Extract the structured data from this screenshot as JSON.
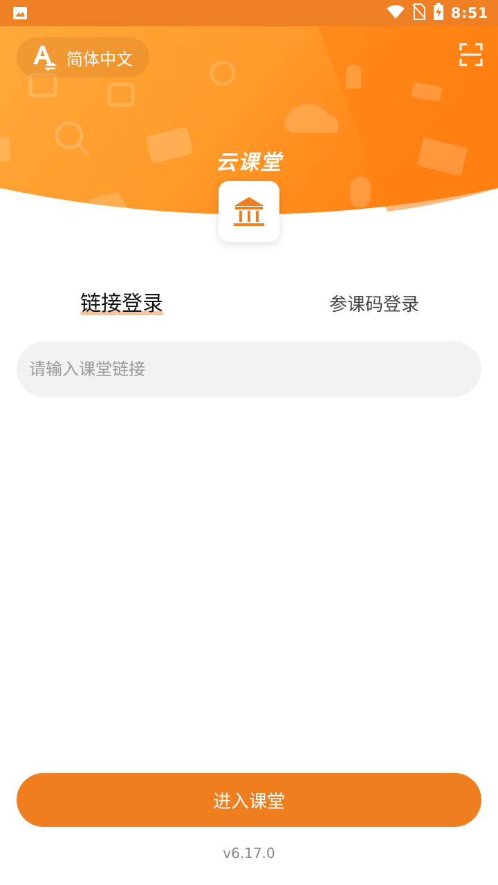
{
  "status_bar": {
    "time": "8:51"
  },
  "header": {
    "language_label": "简体中文",
    "app_title": "云课堂"
  },
  "tabs": [
    {
      "label": "链接登录",
      "active": true
    },
    {
      "label": "参课码登录",
      "active": false
    }
  ],
  "input": {
    "placeholder": "请输入课堂链接",
    "value": ""
  },
  "enter_button": {
    "label": "进入课堂"
  },
  "version": "v6.17.0",
  "colors": {
    "accent": "#ef7f1e",
    "header_light": "#ffa93a",
    "header_dark": "#ff7f10"
  }
}
